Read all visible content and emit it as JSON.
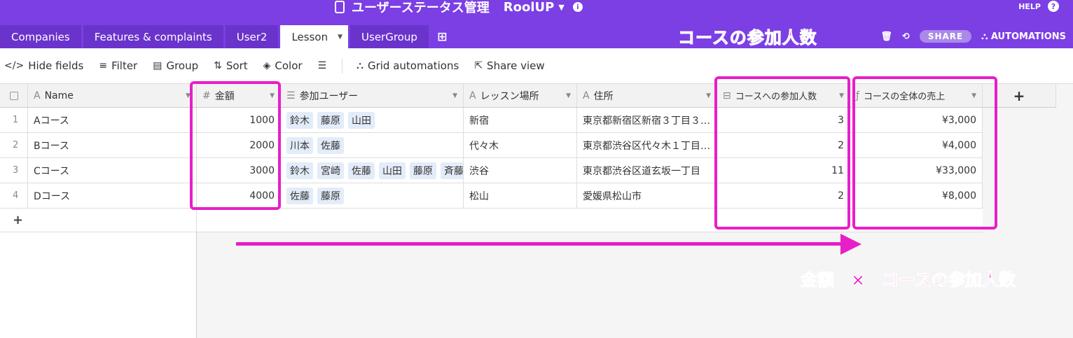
{
  "header": {
    "app_title": "ユーザーステータス管理",
    "workspace": "RoolUP",
    "help_label": "HELP",
    "tabs": [
      {
        "label": "Companies"
      },
      {
        "label": "Features & complaints"
      },
      {
        "label": "User2"
      },
      {
        "label": "Lesson"
      },
      {
        "label": "UserGroup"
      }
    ],
    "share_label": "SHARE",
    "automations_label": "AUTOMATIONS"
  },
  "toolbar": {
    "hide_fields": "Hide fields",
    "filter": "Filter",
    "group": "Group",
    "sort": "Sort",
    "color": "Color",
    "grid_automations": "Grid automations",
    "share_view": "Share view"
  },
  "columns": [
    "Name",
    "金額",
    "参加ユーザー",
    "レッスン場所",
    "住所",
    "コースへの参加人数",
    "コースの全体の売上"
  ],
  "rows": [
    {
      "num": "1",
      "name": "Aコース",
      "amount": "1000",
      "users": [
        "鈴木",
        "藤原",
        "山田"
      ],
      "place": "新宿",
      "address": "東京都新宿区新宿３丁目３…",
      "count": "3",
      "revenue": "¥3,000"
    },
    {
      "num": "2",
      "name": "Bコース",
      "amount": "2000",
      "users": [
        "川本",
        "佐藤"
      ],
      "place": "代々木",
      "address": "東京都渋谷区代々木１丁目…",
      "count": "2",
      "revenue": "¥4,000"
    },
    {
      "num": "3",
      "name": "Cコース",
      "amount": "3000",
      "users": [
        "鈴木",
        "宮崎",
        "佐藤",
        "山田",
        "藤原",
        "斉藤"
      ],
      "place": "渋谷",
      "address": "東京都渋谷区道玄坂一丁目",
      "count": "11",
      "revenue": "¥33,000"
    },
    {
      "num": "4",
      "name": "Dコース",
      "amount": "4000",
      "users": [
        "佐藤",
        "藤原"
      ],
      "place": "松山",
      "address": "愛媛県松山市",
      "count": "2",
      "revenue": "¥8,000"
    }
  ],
  "annotations": {
    "top": "コースの参加人数",
    "bottom": "金額　×　コースの参加人数"
  },
  "colors": {
    "brand": "#7b3fe4",
    "highlight": "#e81ec8"
  }
}
